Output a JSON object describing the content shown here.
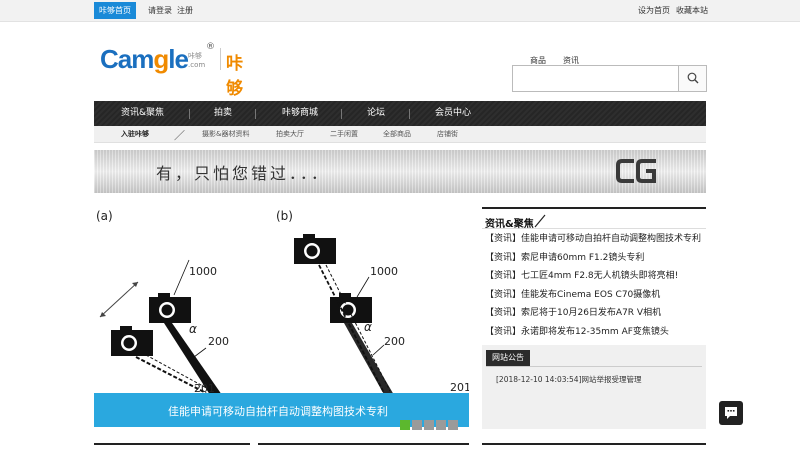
{
  "topbar": {
    "home": "咔够首页",
    "login": "请登录",
    "register": "注册",
    "set_home": "设为首页",
    "bookmark": "收藏本站"
  },
  "logo": {
    "en_left": "Cam",
    "en_g": "g",
    "en_right": "le",
    "small_top": "咔够",
    "small_bottom": ".com",
    "reg": "®",
    "cn": "咔够网"
  },
  "search": {
    "tabs": [
      "商品",
      "资讯"
    ],
    "value": "",
    "placeholder": ""
  },
  "nav": {
    "items": [
      "资讯&聚焦",
      "拍卖",
      "咔够商城",
      "论坛",
      "会员中心"
    ]
  },
  "subnav": {
    "items": [
      "入驻咔够",
      "摄影&器材资料",
      "拍卖大厅",
      "二手闲置",
      "全部商品",
      "店铺街"
    ]
  },
  "banner": {
    "text": "有，只怕您错过．．．",
    "logo": "CG"
  },
  "slide": {
    "caption": "佳能申请可移动自拍杆自动调整构图技术专利",
    "fig_labels": [
      "(a)",
      "(b)",
      "1000",
      "200",
      "201",
      "α",
      "1000",
      "200",
      "201",
      "α"
    ],
    "dots": 5,
    "active_dot": 0
  },
  "news": {
    "title": "资讯&聚焦",
    "items": [
      {
        "tag": "【资讯】",
        "text": "佳能申请可移动自拍杆自动调整构图技术专利"
      },
      {
        "tag": "【资讯】",
        "text": "索尼申请60mm F1.2镜头专利"
      },
      {
        "tag": "【资讯】",
        "text": "七工匠4mm F2.8无人机镜头即将亮相!"
      },
      {
        "tag": "【资讯】",
        "text": "佳能发布Cinema EOS C70摄像机"
      },
      {
        "tag": "【资讯】",
        "text": "索尼将于10月26日发布A7R V相机"
      },
      {
        "tag": "【资讯】",
        "text": "永诺即将发布12-35mm AF变焦镜头"
      }
    ]
  },
  "notice": {
    "title": "网站公告",
    "item": "[2018-12-10 14:03:54]网站举报受理管理"
  },
  "colors": {
    "brand_blue": "#1a6fbf",
    "brand_orange": "#f08a00",
    "caption_blue": "#2aa8df",
    "active_dot": "#5cb82e",
    "nav_dark": "#2b2b2b"
  }
}
